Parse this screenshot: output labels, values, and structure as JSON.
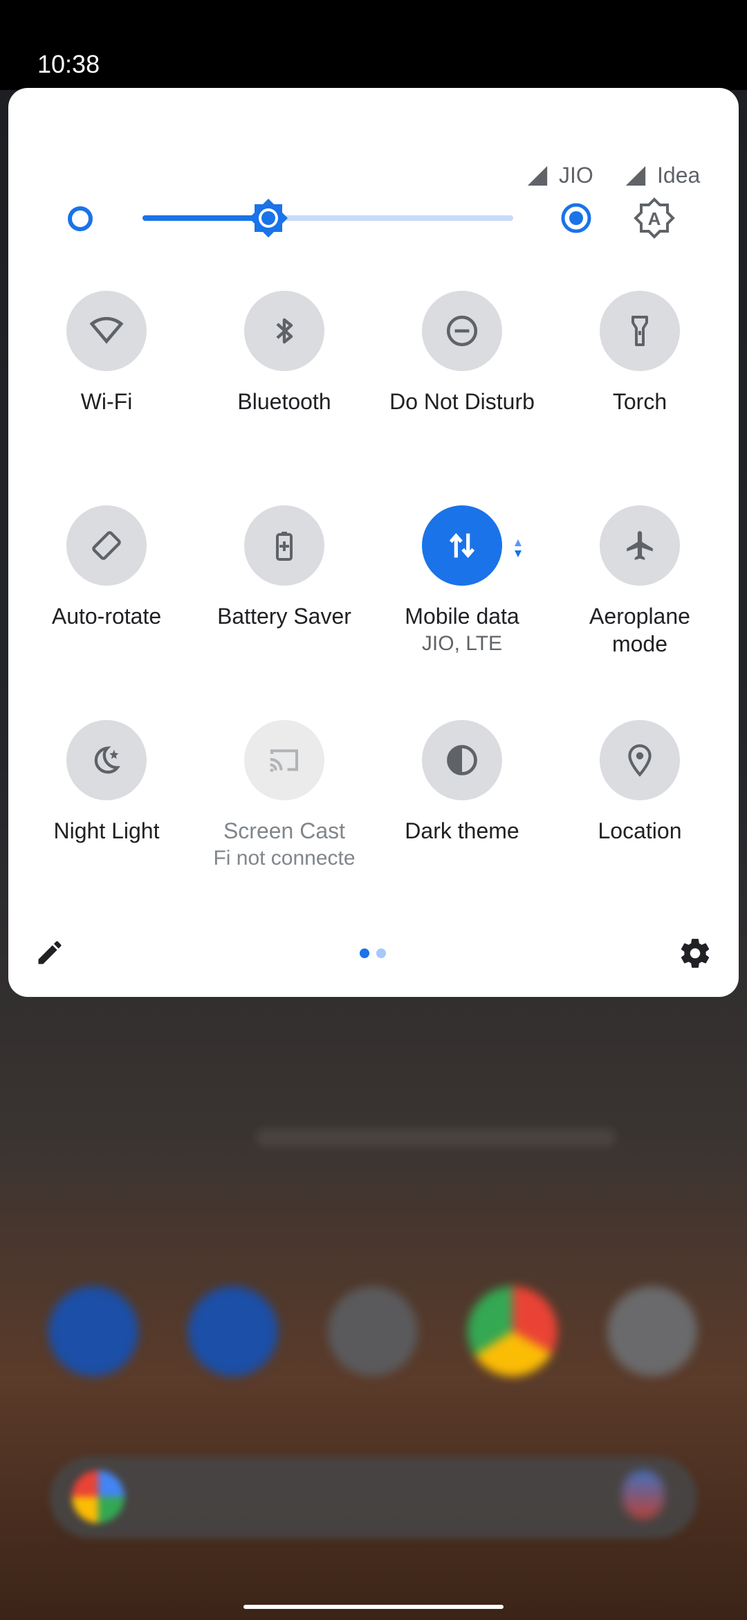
{
  "status_bar": {
    "time": "10:38"
  },
  "carriers": [
    {
      "name": "JIO"
    },
    {
      "name": "Idea"
    }
  ],
  "brightness": {
    "level_percent": 34,
    "accent_color": "#1a73e8",
    "track_color": "#c6dafc"
  },
  "tiles": [
    {
      "label": "Wi-Fi",
      "icon": "wifi-icon",
      "state": "off"
    },
    {
      "label": "Bluetooth",
      "icon": "bluetooth-icon",
      "state": "off"
    },
    {
      "label": "Do Not Disturb",
      "icon": "do-not-disturb-icon",
      "state": "off"
    },
    {
      "label": "Torch",
      "icon": "torch-icon",
      "state": "off"
    },
    {
      "label": "Auto-rotate",
      "icon": "auto-rotate-icon",
      "state": "off"
    },
    {
      "label": "Battery Saver",
      "icon": "battery-saver-icon",
      "state": "off"
    },
    {
      "label": "Mobile data",
      "sublabel": "JIO, LTE",
      "icon": "mobile-data-icon",
      "state": "on"
    },
    {
      "label": "Aeroplane mode",
      "label_line1": "Aeroplane",
      "label_line2": "mode",
      "icon": "airplane-icon",
      "state": "off"
    },
    {
      "label": "Night Light",
      "icon": "night-light-icon",
      "state": "off"
    },
    {
      "label": "Screen Cast",
      "sublabel": "Fi not connecte",
      "icon": "cast-icon",
      "state": "unavailable"
    },
    {
      "label": "Dark theme",
      "icon": "dark-theme-icon",
      "state": "off"
    },
    {
      "label": "Location",
      "icon": "location-icon",
      "state": "off"
    }
  ],
  "footer": {
    "edit_icon": "pencil-icon",
    "settings_icon": "gear-icon",
    "pages": 2,
    "current_page": 1
  },
  "colors": {
    "active_tile": "#1a73e8",
    "inactive_tile": "#dadce0",
    "panel_background": "#ffffff"
  }
}
